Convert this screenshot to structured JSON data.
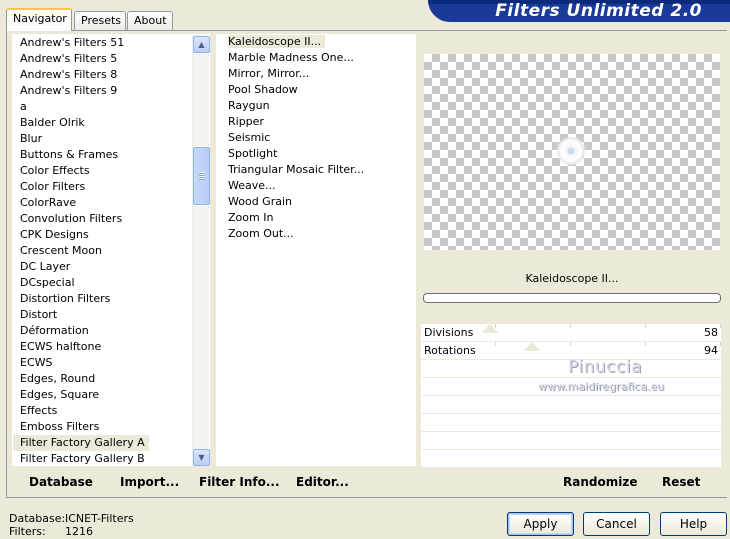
{
  "tabs": [
    {
      "label": "Navigator",
      "active": true
    },
    {
      "label": "Presets",
      "active": false
    },
    {
      "label": "About",
      "active": false
    }
  ],
  "banner_title": "Filters Unlimited 2.0",
  "categories": [
    "Andrew's Filters 51",
    "Andrew's Filters 5",
    "Andrew's Filters 8",
    "Andrew's Filters 9",
    "a",
    "Balder Olrik",
    "Blur",
    "Buttons & Frames",
    "Color Effects",
    "Color Filters",
    "ColorRave",
    "Convolution Filters",
    "CPK Designs",
    "Crescent Moon",
    "DC Layer",
    "DCspecial",
    "Distortion Filters",
    "Distort",
    "Déformation",
    "ECWS halftone",
    "ECWS",
    "Edges, Round",
    "Edges, Square",
    "Effects",
    "Emboss Filters",
    "Filter Factory Gallery A",
    "Filter Factory Gallery B"
  ],
  "selected_category": "Filter Factory Gallery A",
  "filters": [
    "Kaleidoscope II...",
    "Marble Madness One...",
    "Mirror, Mirror...",
    "Pool Shadow",
    "Raygun",
    "Ripper",
    "Seismic",
    "Spotlight",
    "Triangular Mosaic Filter...",
    "Weave...",
    "Wood Grain",
    "Zoom In",
    "Zoom Out..."
  ],
  "selected_filter": "Kaleidoscope II...",
  "preview_title": "Kaleidoscope II...",
  "params": [
    {
      "label": "Divisions",
      "value": "58",
      "fraction": 0.23
    },
    {
      "label": "Rotations",
      "value": "94",
      "fraction": 0.37
    }
  ],
  "watermark": {
    "name": "Pinuccia",
    "url": "www.maidiregrafica.eu"
  },
  "toolbar": {
    "database": "Database",
    "import": "Import...",
    "filter_info": "Filter Info...",
    "editor": "Editor...",
    "randomize": "Randomize",
    "reset": "Reset"
  },
  "status": {
    "database_label": "Database:",
    "database_value": "ICNET-Filters",
    "filters_label": "Filters:",
    "filters_value": "1216"
  },
  "buttons": {
    "apply": "Apply",
    "cancel": "Cancel",
    "help": "Help"
  }
}
